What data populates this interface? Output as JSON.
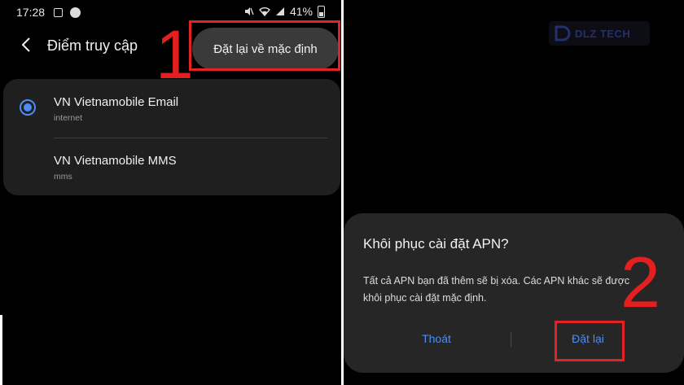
{
  "status_bar": {
    "time": "17:28",
    "battery": "41%"
  },
  "apn_screen": {
    "title": "Điểm truy cập",
    "menu_reset_label": "Đặt lại về mặc định",
    "apns": [
      {
        "name": "VN Vietnamobile Email",
        "type": "internet",
        "selected": true
      },
      {
        "name": "VN Vietnamobile MMS",
        "type": "mms",
        "selected": false
      }
    ]
  },
  "annotations": {
    "step_1": "1",
    "step_2": "2",
    "highlight_color": "#e02424"
  },
  "watermark": {
    "text": "DLZ TECH"
  },
  "dialog": {
    "title": "Khôi phục cài đặt APN?",
    "body": "Tất cả APN bạn đã thêm sẽ bị xóa. Các APN khác sẽ được khôi phục cài đặt mặc định.",
    "cancel_label": "Thoát",
    "confirm_label": "Đặt lại"
  },
  "colors": {
    "accent": "#4e8cf4",
    "background": "#000000",
    "card": "#1f1f1f",
    "dialog": "#262626"
  }
}
